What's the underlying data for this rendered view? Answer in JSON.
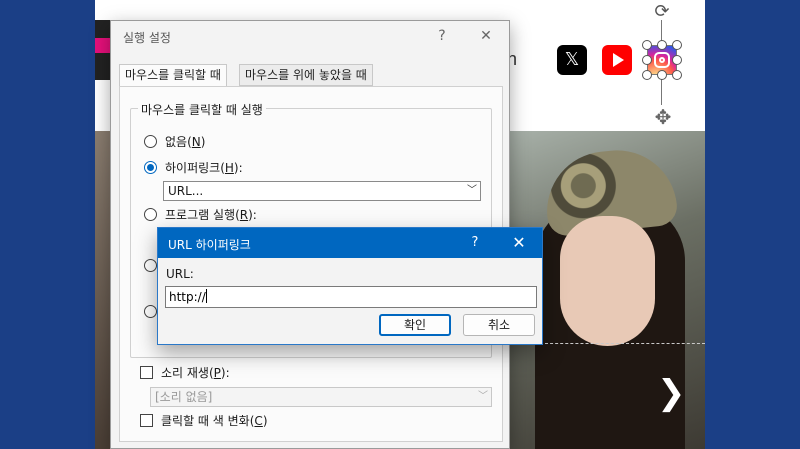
{
  "action_dialog": {
    "title": "실행 설정",
    "help": "?",
    "close": "✕",
    "tabs": [
      "마우스를 클릭할 때",
      "마우스를 위에 놓았을 때"
    ],
    "group_title": "마우스를 클릭할 때 실행",
    "radio_none": {
      "label": "없음",
      "key": "N"
    },
    "radio_hyperlink": {
      "label": "하이퍼링크",
      "key": "H",
      "suffix": ":"
    },
    "hyperlink_select": "URL...",
    "radio_program": {
      "label": "프로그램 실행",
      "key": "R",
      "suffix": ":"
    },
    "sound_check": {
      "label": "소리 재생",
      "key": "P",
      "suffix": ":"
    },
    "sound_select": "[소리 없음]",
    "highlight_check": {
      "label": "클릭할 때 색 변화",
      "key": "C"
    }
  },
  "url_dialog": {
    "title": "URL 하이퍼링크",
    "help": "?",
    "close": "✕",
    "label": "URL:",
    "value": "http://",
    "ok": "확인",
    "cancel": "취소"
  },
  "slide": {
    "partial_text": "n",
    "next_arrow": "❯",
    "x_logo": "𝕏",
    "icons": [
      "x-logo-icon",
      "youtube-icon",
      "instagram-icon",
      "rotate-icon",
      "move-icon"
    ]
  }
}
